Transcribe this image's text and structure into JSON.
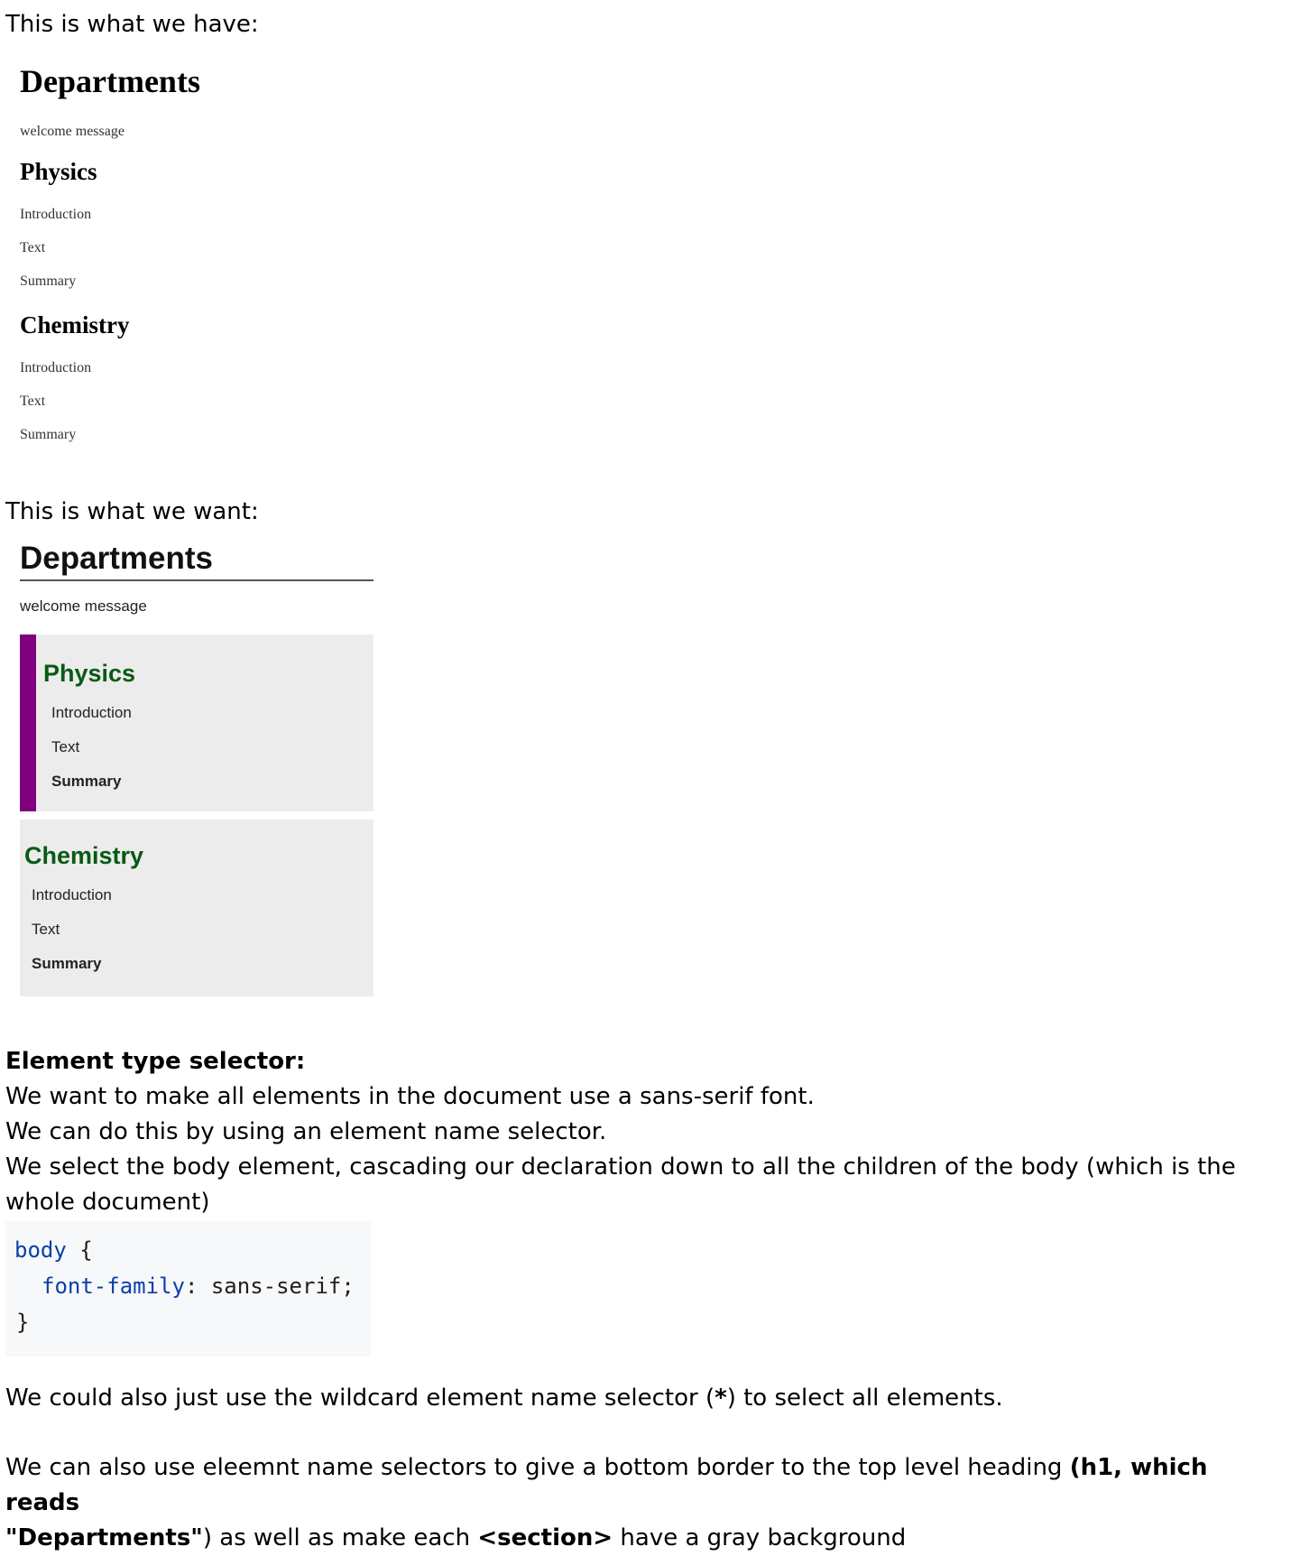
{
  "intro_have": "This is what we have:",
  "intro_want": "This is what we want:",
  "demo": {
    "heading": "Departments",
    "welcome": "welcome message",
    "sections": [
      {
        "title": "Physics",
        "items": [
          "Introduction",
          "Text",
          "Summary"
        ]
      },
      {
        "title": "Chemistry",
        "items": [
          "Introduction",
          "Text",
          "Summary"
        ]
      }
    ]
  },
  "colors": {
    "section_bg": "#ececec",
    "accent_bar": "#800080",
    "section_title": "#0a5a14",
    "code_bg": "#f6f8fa",
    "code_keyword": "#0b3fa8"
  },
  "selector_heading": "Element type selector:",
  "paragraph1": [
    "We want to make all elements in the document use a sans-serif font.",
    "We can do this by using an element name selector.",
    "We select the body element, cascading our declaration down to all the children of the body (which is the",
    "whole document)"
  ],
  "code": {
    "selector": "body",
    "open_brace": " {",
    "property": "font-family",
    "value": ": sans-serif;",
    "close_brace": "}"
  },
  "wildcard": {
    "before": "We could also just use the wildcard element name selector (",
    "symbol": "*",
    "after": ") to select all elements."
  },
  "final": {
    "part1": "We can also use eleemnt name selectors to give a bottom border to the top level heading ",
    "bold1": "(h1, which reads",
    "bold2": "\"Departments\"",
    "part2": ") as well as make each ",
    "bold3": "<section>",
    "part3": " have a gray background"
  }
}
